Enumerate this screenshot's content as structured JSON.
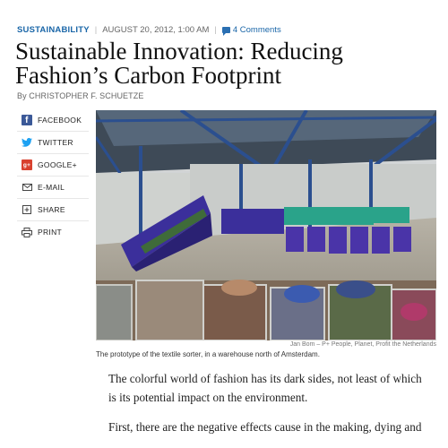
{
  "article": {
    "section": "SUSTAINABILITY",
    "date": "AUGUST 20, 2012, 1:00 AM",
    "comments": "4 Comments",
    "title_line1": "Sustainable Innovation: Reducing",
    "title_line2": "Fashion’s Carbon Footprint",
    "byline": "By CHRISTOPHER F. SCHUETZE",
    "photo_credit": "Jan Bom – P+ People, Planet, Profit the Netherlands",
    "caption": "The prototype of the textile sorter, in a warehouse north of Amsterdam.",
    "paragraph1": "The colorful world of fashion has its dark sides, not least of which is its potential impact on the environment.",
    "paragraph2": "First, there are the negative effects cause in the making, dying and"
  },
  "share": {
    "facebook": "FACEBOOK",
    "twitter": "TWITTER",
    "google": "GOOGLE+",
    "email": "E-MAIL",
    "share": "SHARE",
    "print": "PRINT"
  },
  "colors": {
    "accent": "#1a66a8",
    "facebook": "#3b5998",
    "twitter": "#1da1f2",
    "google": "#d8412f"
  },
  "icons": [
    "comment-icon",
    "facebook-icon",
    "twitter-icon",
    "google-plus-icon",
    "email-icon",
    "share-icon",
    "print-icon"
  ]
}
